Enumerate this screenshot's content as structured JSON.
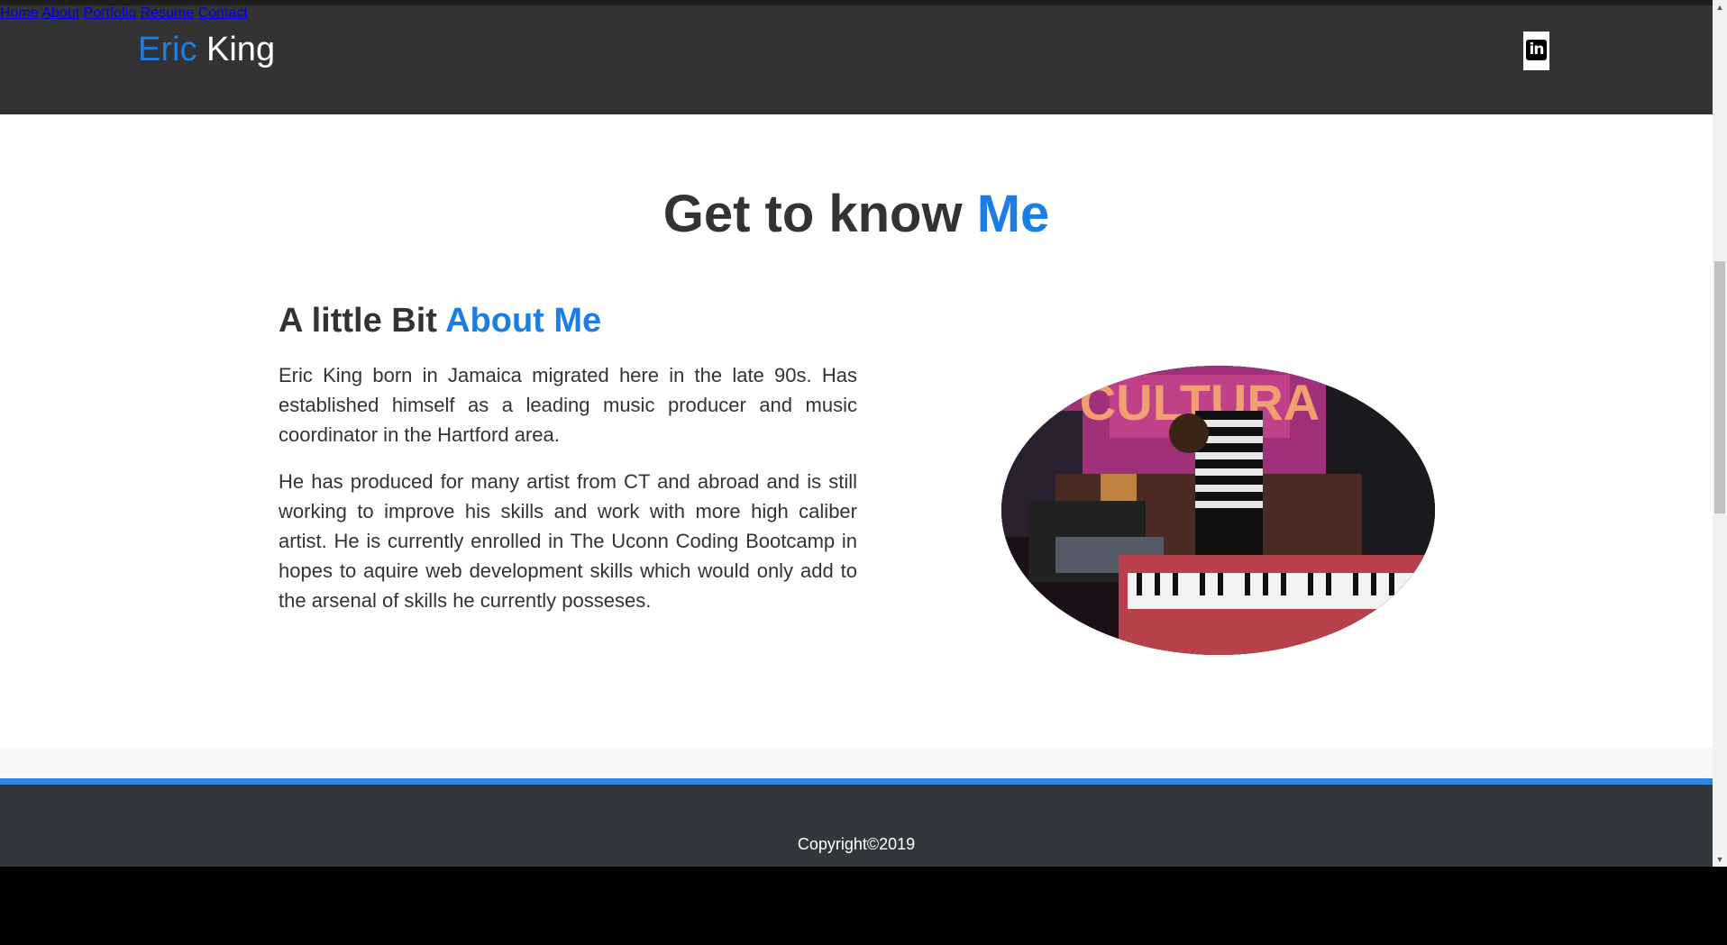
{
  "brand": {
    "first": "Eric",
    "last": "King"
  },
  "nav": {
    "items": [
      {
        "label": "Home"
      },
      {
        "label": "About"
      },
      {
        "label": "Portfolio"
      },
      {
        "label": "Resume"
      },
      {
        "label": "Contact"
      }
    ],
    "social_icon": "linkedin-icon",
    "social_glyph": "in"
  },
  "hero": {
    "title_main": "Get to know",
    "title_accent": "Me"
  },
  "about": {
    "heading_main": "A little Bit",
    "heading_accent": "About Me",
    "paragraphs": [
      "Eric King born in Jamaica migrated here in the late 90s. Has established himself as a leading music producer and music coordinator in the Hartford area.",
      "He has produced for many artist from CT and abroad and is still working to improve his skills and work with more high caliber artist. He is currently enrolled in The Uconn Coding Bootcamp in hopes to aquire web development skills which would only add to the arsenal of skills he currently posseses."
    ],
    "photo_sign": "CULTURA"
  },
  "footer": {
    "copyright": "Copyright©2019"
  },
  "colors": {
    "accent": "#1a7ee6",
    "navbar": "#333333",
    "footer": "#33363d",
    "footer_border": "#2f86e0"
  }
}
